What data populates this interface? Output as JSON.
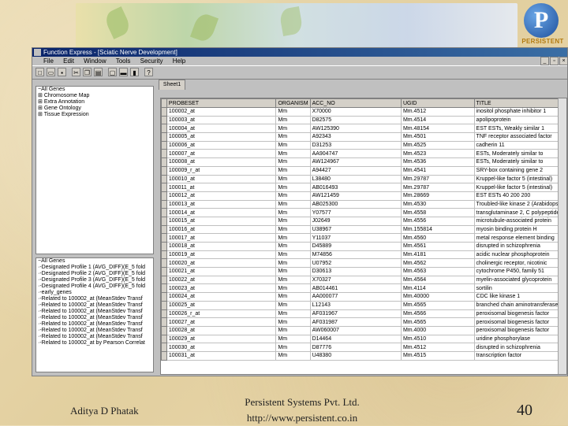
{
  "window": {
    "title": "Function Express - [Sciatic Nerve Development]",
    "menu": [
      "File",
      "Edit",
      "Window",
      "Tools",
      "Security",
      "Help"
    ]
  },
  "tree_top": [
    "All Genes",
    "Chromosome Map",
    "Extra Annotation",
    "Gene Ontology",
    "Tissue Expression"
  ],
  "tree_bottom": [
    "All Genes",
    "Designated Profile 1 (AVG_DIFF)(E_5 fold",
    "Designated Profile 2 (AVG_DIFF)(E_5 fold",
    "Designated Profile 3 (AVG_DIFF)(E_5 fold",
    "Designated Profile 4 (AVG_DIFF)(E_5 fold",
    "early_genes",
    "Related to 100002_at (MeanStdev Transf",
    "Related to 100002_at (MeanStdev Transf",
    "Related to 100002_at (MeanStdev Transf",
    "Related to 100002_at (MeanStdev Transf",
    "Related to 100002_at (MeanStdev Transf",
    "Related to 100002_at (MeanStdev Transf",
    "Related to 100002_at (MeanStdev Transf",
    "Related to 100002_at by Pearson Correlat"
  ],
  "tab_label": "Sheet1",
  "table": {
    "columns": [
      "PROBESET",
      "ORGANISM",
      "ACC_NO",
      "UGID",
      "TITLE"
    ],
    "rows": [
      [
        "100002_at",
        "Mm",
        "X70000",
        "Mm.4512",
        "inositol phosphate inhibitor 1"
      ],
      [
        "100003_at",
        "Mm",
        "D82575",
        "Mm.4514",
        "apolipoprotein"
      ],
      [
        "100004_at",
        "Mm",
        "AW125390",
        "Mm.48154",
        "EST ESTs, Weakly similar 1"
      ],
      [
        "100005_at",
        "Mm",
        "A92343",
        "Mm.4501",
        "TNF receptor associated factor"
      ],
      [
        "100006_at",
        "Mm",
        "D31253",
        "Mm.4525",
        "cadherin 11"
      ],
      [
        "100007_at",
        "Mm",
        "AA904747",
        "Mm.4523",
        "ESTs, Moderately similar to"
      ],
      [
        "100008_at",
        "Mm",
        "AW124967",
        "Mm.4536",
        "ESTs, Moderately similar to"
      ],
      [
        "100009_r_at",
        "Mm",
        "A94427",
        "Mm.4541",
        "SRY-box containing gene 2"
      ],
      [
        "100010_at",
        "Mm",
        "L38480",
        "Mm.29787",
        "Kruppel-like factor 5 (intestinal)"
      ],
      [
        "100011_at",
        "Mm",
        "AB016493",
        "Mm.29787",
        "Kruppel-like factor 5 (intestinal)"
      ],
      [
        "100012_at",
        "Mm",
        "AW121459",
        "Mm.28669",
        "EST ESTs 40 200 200"
      ],
      [
        "100013_at",
        "Mm",
        "AB025300",
        "Mm.4530",
        "Troubled-like kinase 2 (Arabidopsis)"
      ],
      [
        "100014_at",
        "Mm",
        "Y07577",
        "Mm.4558",
        "transglutaminase 2, C polypeptide"
      ],
      [
        "100015_at",
        "Mm",
        "J02649",
        "Mm.4556",
        "microtubule-associated protein"
      ],
      [
        "100016_at",
        "Mm",
        "U38967",
        "Mm.155814",
        "myosin binding protein H"
      ],
      [
        "100017_at",
        "Mm",
        "Y11037",
        "Mm.4560",
        "metal response element binding"
      ],
      [
        "100018_at",
        "Mm",
        "D45889",
        "Mm.4561",
        "disrupted in schizophrenia"
      ],
      [
        "100019_at",
        "Mm",
        "M74856",
        "Mm.4181",
        "acidic nuclear phosphoprotein"
      ],
      [
        "100020_at",
        "Mm",
        "U07952",
        "Mm.4562",
        "cholinergic receptor, nicotinic"
      ],
      [
        "100021_at",
        "Mm",
        "D30613",
        "Mm.4563",
        "cytochrome P450, family 51"
      ],
      [
        "100022_at",
        "Mm",
        "X70327",
        "Mm.4564",
        "myelin-associated glycoprotein"
      ],
      [
        "100023_at",
        "Mm",
        "AB014461",
        "Mm.4114",
        "sortilin"
      ],
      [
        "100024_at",
        "Mm",
        "AA000077",
        "Mm.40000",
        "CDC like kinase 1"
      ],
      [
        "100025_at",
        "Mm",
        "L12143",
        "Mm.4565",
        "branched chain aminotransferase"
      ],
      [
        "100026_r_at",
        "Mm",
        "AF031967",
        "Mm.4566",
        "peroxisomal biogenesis factor"
      ],
      [
        "100027_at",
        "Mm",
        "AF031987",
        "Mm.4565",
        "peroxisomal biogenesis factor"
      ],
      [
        "100028_at",
        "Mm",
        "AW060007",
        "Mm.4000",
        "peroxisomal biogenesis factor"
      ],
      [
        "100029_at",
        "Mm",
        "D14464",
        "Mm.4510",
        "uridine phosphorylase"
      ],
      [
        "100030_at",
        "Mm",
        "D87776",
        "Mm.4512",
        "disrupted in schizophrenia"
      ],
      [
        "100031_at",
        "Mm",
        "U48380",
        "Mm.4515",
        "transcription factor"
      ]
    ]
  },
  "footer": {
    "author": "Aditya D Phatak",
    "company": "Persistent Systems Pvt. Ltd.",
    "url": "http://www.persistent.co.in",
    "page_number": "40"
  },
  "logo": {
    "letter": "P",
    "text": "PERSISTENT"
  },
  "colors": {
    "titlebar": "#0a246a",
    "window_bg": "#c0c0c0",
    "slide_bg": "#e2cf9f"
  }
}
